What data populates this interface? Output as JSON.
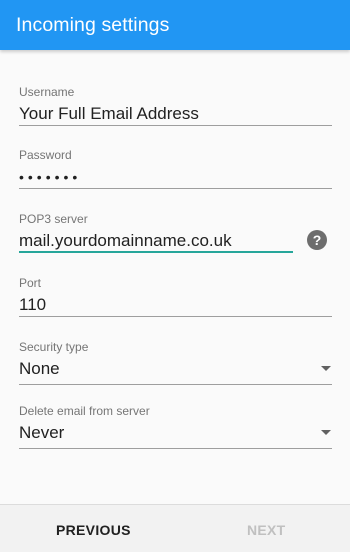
{
  "app_bar": {
    "title": "Incoming settings",
    "background_color": "#2196f3"
  },
  "form": {
    "username": {
      "label": "Username",
      "value": "Your Full Email Address"
    },
    "password": {
      "label": "Password",
      "value": "•••••••"
    },
    "pop3_server": {
      "label": "POP3 server",
      "value": "mail.yourdomainname.co.uk",
      "help_icon": "?",
      "focused": true,
      "focus_color": "#26a69a"
    },
    "port": {
      "label": "Port",
      "value": "110"
    },
    "security_type": {
      "label": "Security type",
      "selected": "None",
      "icon": "dropdown-arrow-icon"
    },
    "delete_email": {
      "label": "Delete email from server",
      "selected": "Never",
      "icon": "dropdown-arrow-icon"
    }
  },
  "navigation": {
    "previous_label": "PREVIOUS",
    "next_label": "NEXT",
    "next_enabled": false
  }
}
